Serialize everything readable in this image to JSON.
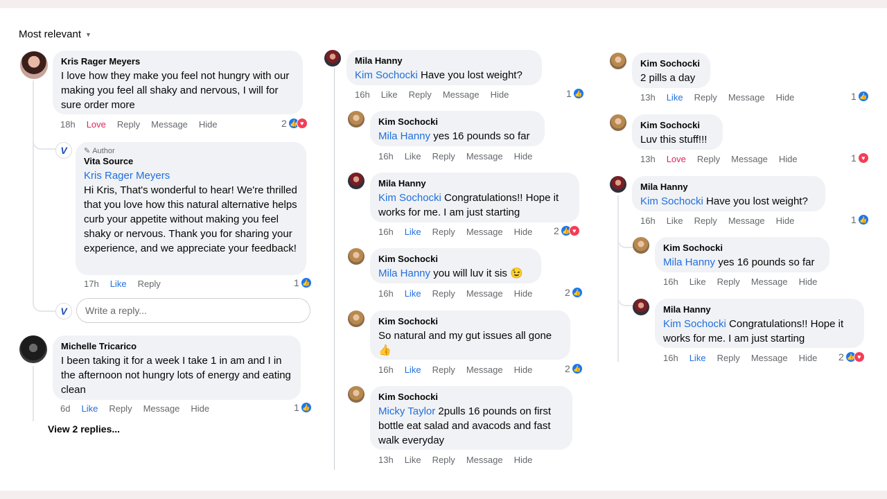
{
  "sort_label": "Most relevant",
  "reply_placeholder": "Write a reply...",
  "view_replies": "View 2 replies...",
  "author_badge": "Author",
  "actions": {
    "like": "Like",
    "love": "Love",
    "reply": "Reply",
    "message": "Message",
    "hide": "Hide"
  },
  "comments": {
    "c1": {
      "name": "Kris Rager Meyers",
      "text": "I love how they make you feel not hungry with our making you feel all shaky and nervous, I will for sure order more",
      "time": "18h",
      "count": "2"
    },
    "c2": {
      "name": "Vita Source",
      "mention": "Kris Rager Meyers",
      "text": "Hi Kris, That's wonderful to hear! We're thrilled that you love how this natural alternative helps curb your appetite without making you feel shaky or nervous. Thank you for sharing your experience, and we appreciate your feedback!",
      "time": "17h",
      "count": "1"
    },
    "c3": {
      "name": "Michelle Tricarico",
      "text": "I been taking it for a week I take 1 in am and I in the afternoon not hungry lots of energy and eating clean",
      "time": "6d",
      "count": "1"
    },
    "c4": {
      "name": "Mila Hanny",
      "mention": "Kim Sochocki",
      "text": "Have you lost weight?",
      "time": "16h",
      "count": "1"
    },
    "c5": {
      "name": "Kim Sochocki",
      "mention": "Mila Hanny",
      "text": "yes 16 pounds so far",
      "time": "16h"
    },
    "c6": {
      "name": "Mila Hanny",
      "mention": "Kim Sochocki",
      "text": "Congratulations!! Hope it works for me. I am just starting",
      "time": "16h",
      "count": "2"
    },
    "c7": {
      "name": "Kim Sochocki",
      "mention": "Mila Hanny",
      "text": "you will luv it sis 😉",
      "time": "16h",
      "count": "2"
    },
    "c8": {
      "name": "Kim Sochocki",
      "text": "So natural and my gut issues all gone 👍",
      "time": "16h",
      "count": "2"
    },
    "c9": {
      "name": "Kim Sochocki",
      "mention": "Micky Taylor",
      "text": "2pulls 16 pounds on first bottle eat salad and avacods and fast walk everyday",
      "time": "13h"
    },
    "c10": {
      "name": "Kim Sochocki",
      "text": "2 pills a day",
      "time": "13h",
      "count": "1"
    },
    "c11": {
      "name": "Kim Sochocki",
      "text": "Luv this stuff!!!",
      "time": "13h",
      "count": "1"
    },
    "c12": {
      "name": "Mila Hanny",
      "mention": "Kim Sochocki",
      "text": "Have you lost weight?",
      "time": "16h",
      "count": "1"
    },
    "c13": {
      "name": "Kim Sochocki",
      "mention": "Mila Hanny",
      "text": "yes 16 pounds so far",
      "time": "16h"
    },
    "c14": {
      "name": "Mila Hanny",
      "mention": "Kim Sochocki",
      "text": "Congratulations!! Hope it works for me. I am just starting",
      "time": "16h",
      "count": "2"
    }
  }
}
